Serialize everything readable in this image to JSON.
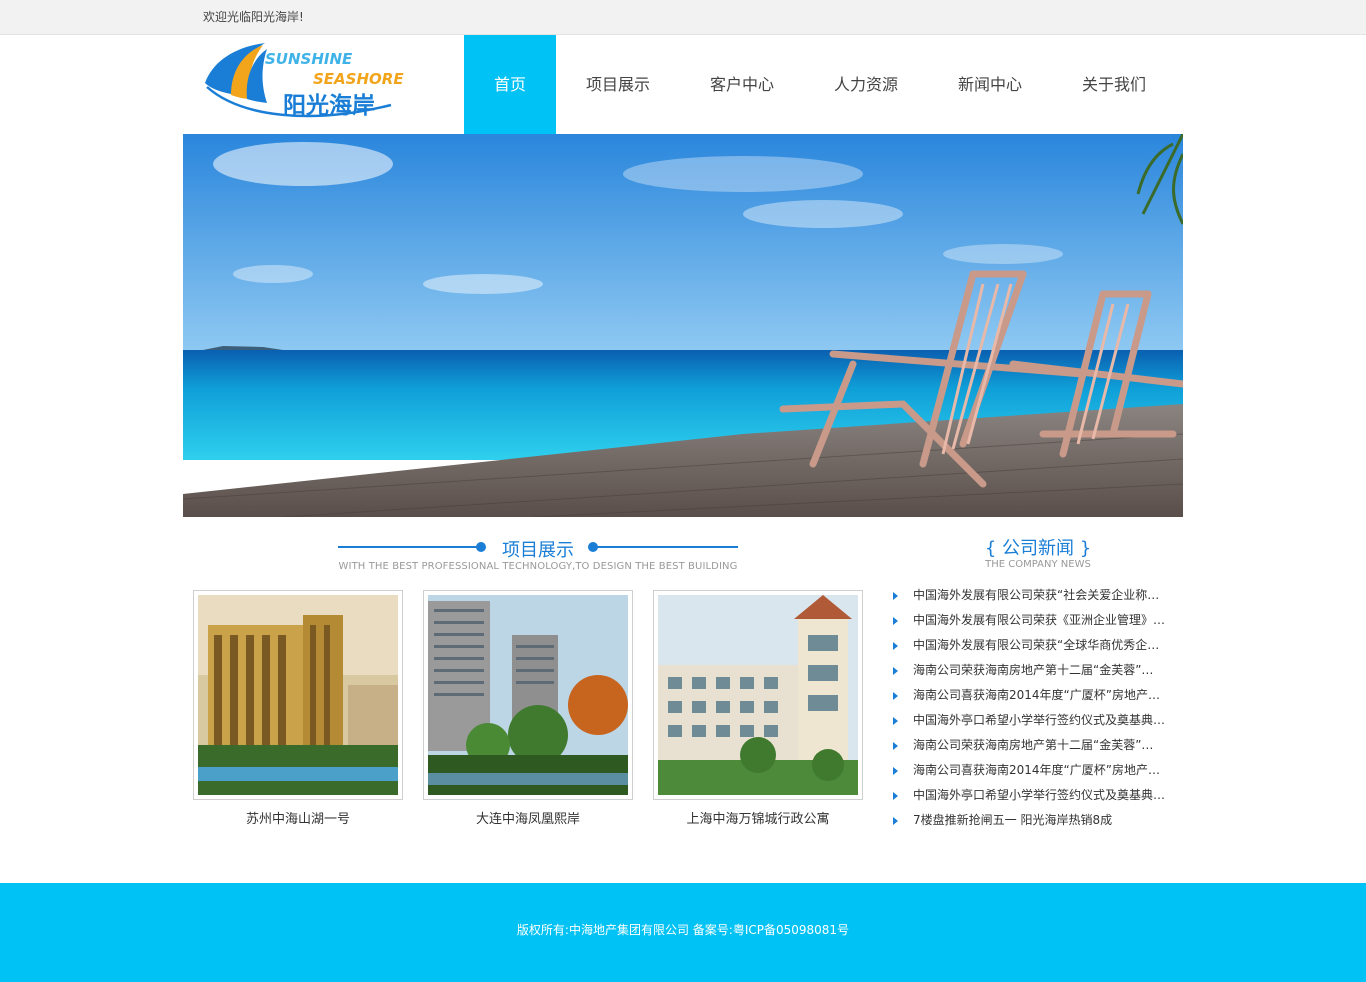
{
  "topbar": {
    "welcome": "欢迎光临阳光海岸!"
  },
  "logo": {
    "line1": "SUNSHINE",
    "line2": "SEASHORE",
    "cn": "阳光海岸"
  },
  "nav": [
    {
      "label": "首页",
      "active": true
    },
    {
      "label": "项目展示",
      "active": false
    },
    {
      "label": "客户中心",
      "active": false
    },
    {
      "label": "人力资源",
      "active": false
    },
    {
      "label": "新闻中心",
      "active": false
    },
    {
      "label": "关于我们",
      "active": false
    }
  ],
  "projects": {
    "title": "项目展示",
    "subtitle": "WITH THE BEST PROFESSIONAL TECHNOLOGY,TO DESIGN THE BEST BUILDING",
    "items": [
      {
        "caption": "苏州中海山湖一号"
      },
      {
        "caption": "大连中海凤凰熙岸"
      },
      {
        "caption": "上海中海万锦城行政公寓"
      }
    ]
  },
  "news": {
    "title": "{ 公司新闻 }",
    "subtitle": "THE COMPANY NEWS",
    "items": [
      "中国海外发展有限公司荣获“社会关爱企业称…",
      "中国海外发展有限公司荣获《亚洲企业管理》…",
      "中国海外发展有限公司荣获“全球华商优秀企…",
      "海南公司荣获海南房地产第十二届“金芙蓉”…",
      "海南公司喜获海南2014年度“广厦杯”房地产…",
      "中国海外亭口希望小学举行签约仪式及奠基典…",
      "海南公司荣获海南房地产第十二届“金芙蓉”…",
      "海南公司喜获海南2014年度“广厦杯”房地产…",
      "中国海外亭口希望小学举行签约仪式及奠基典…",
      "7楼盘推新抢闸五一 阳光海岸热销8成"
    ]
  },
  "footer": {
    "text": "版权所有:中海地产集团有限公司 备案号:粤ICP备05098081号"
  },
  "colors": {
    "accent": "#00c2f5",
    "heading": "#1a7ed6"
  }
}
